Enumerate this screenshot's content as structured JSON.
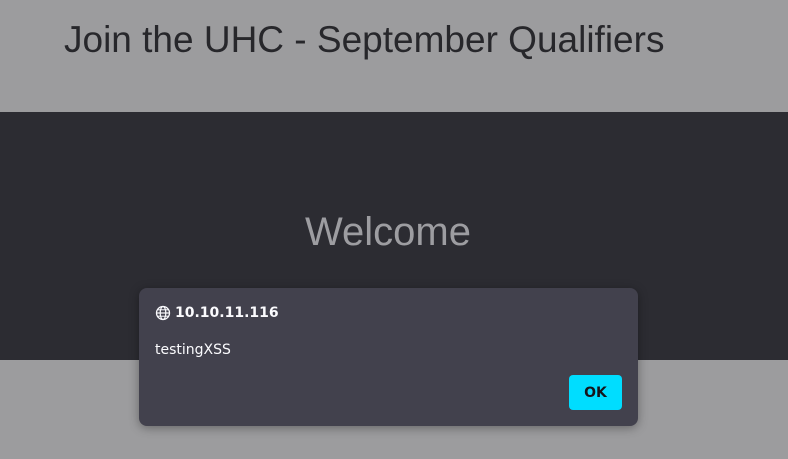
{
  "header": {
    "title": "Join the UHC - September Qualifiers"
  },
  "hero": {
    "heading": "Welcome"
  },
  "dialog": {
    "origin": "10.10.11.116",
    "origin_icon": "globe-icon",
    "message": "testingXSS",
    "ok_label": "OK",
    "accent_color": "#00ddff"
  }
}
